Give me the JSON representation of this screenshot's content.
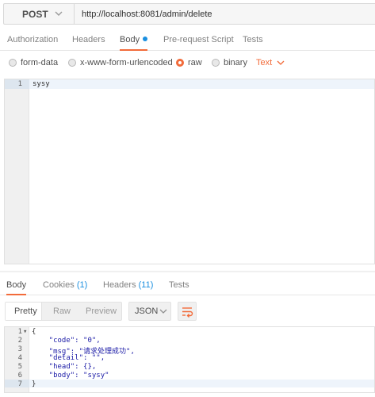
{
  "request": {
    "method": "POST",
    "url": "http://localhost:8081/admin/delete"
  },
  "request_tabs": {
    "authorization": "Authorization",
    "headers": "Headers",
    "body": "Body",
    "pre_request": "Pre-request Script",
    "tests": "Tests"
  },
  "body_types": {
    "form_data": "form-data",
    "urlencoded": "x-www-form-urlencoded",
    "raw": "raw",
    "binary": "binary",
    "selected": "raw",
    "text_format": "Text"
  },
  "request_editor": {
    "line_numbers": [
      "1"
    ],
    "lines": [
      "sysy"
    ]
  },
  "response_tabs": {
    "body": "Body",
    "cookies": "Cookies",
    "cookies_count": "(1)",
    "headers": "Headers",
    "headers_count": "(11)",
    "tests": "Tests"
  },
  "response_toolbar": {
    "pretty": "Pretty",
    "raw": "Raw",
    "preview": "Preview",
    "format": "JSON"
  },
  "response_editor": {
    "line_numbers": [
      "1",
      "2",
      "3",
      "4",
      "5",
      "6",
      "7"
    ],
    "fold_marker": "▾",
    "lines": [
      "{",
      "    \"code\": \"0\",",
      "    \"msg\": \"请求处理成功\",",
      "    \"detail\": \"\",",
      "    \"head\": {},",
      "    \"body\": \"sysy\"",
      "}"
    ]
  },
  "colors": {
    "accent": "#f26b3a",
    "link": "#1a8fe0"
  }
}
